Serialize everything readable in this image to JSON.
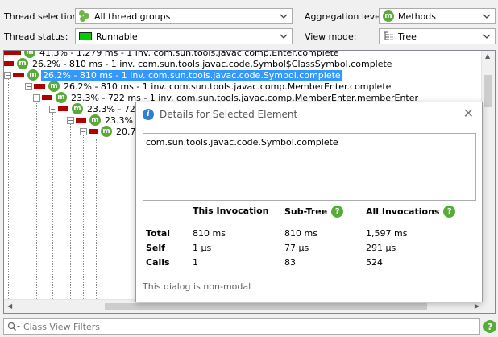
{
  "toolbar": {
    "thread_selection_label": "Thread selection:",
    "thread_selection_value": "All thread groups",
    "thread_status_label": "Thread status:",
    "thread_status_value": "Runnable",
    "aggregation_label": "Aggregation level:",
    "aggregation_value": "Methods",
    "view_mode_label": "View mode:",
    "view_mode_value": "Tree"
  },
  "tree": {
    "rows": [
      {
        "text": "41.3% - 1,279 ms - 1 inv. com.sun.tools.javac.comp.Enter.complete",
        "bar_pct": 41.3
      },
      {
        "text": "26.2% - 810 ms - 1 inv. com.sun.tools.javac.code.Symbol$ClassSymbol.complete",
        "bar_pct": 26.2
      },
      {
        "text": "26.2% - 810 ms - 1 inv. com.sun.tools.javac.code.Symbol.complete",
        "bar_pct": 26.2,
        "selected": true
      },
      {
        "text": "26.2% - 810 ms - 1 inv. com.sun.tools.javac.comp.MemberEnter.complete",
        "bar_pct": 26.2
      },
      {
        "text": "23.3% - 722 ms - 1 inv. com.sun.tools.javac.comp.MemberEnter.memberEnter",
        "bar_pct": 23.3
      },
      {
        "text": "23.3% - 722",
        "bar_pct": 23.3
      },
      {
        "text": "23.3% -",
        "bar_pct": 23.3
      },
      {
        "text": "20.7",
        "bar_pct": 20.7
      }
    ]
  },
  "filter": {
    "placeholder": "Class View Filters",
    "help": "?"
  },
  "dialog": {
    "title": "Details for Selected Element",
    "close": "✕",
    "selected_text": "com.sun.tools.javac.code.Symbol.complete",
    "columns": [
      "This Invocation",
      "Sub-Tree",
      "All Invocations"
    ],
    "rows": [
      {
        "label": "Total",
        "values": [
          "810 ms",
          "810 ms",
          "1,597 ms"
        ]
      },
      {
        "label": "Self",
        "values": [
          "1 µs",
          "77 µs",
          "291 µs"
        ]
      },
      {
        "label": "Calls",
        "values": [
          "1",
          "83",
          "524"
        ]
      }
    ],
    "help": "?",
    "footer": "This dialog is non-modal"
  },
  "icons": {
    "method_glyph": "m"
  },
  "colors": {
    "selection": "#3399ff",
    "bar": "#b00000",
    "runnable": "#00cc00",
    "method_icon": "#5aaa3a"
  }
}
